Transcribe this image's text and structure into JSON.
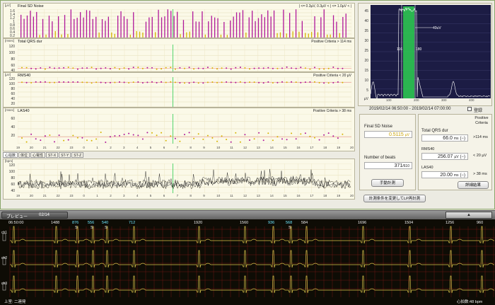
{
  "trend": {
    "noise": {
      "unit": "[µV]",
      "title": "Final SD Noise",
      "legend": "| <= 0.3µV, 0.3µV < | <= 1.0µV < |",
      "yticks": [
        "1.6",
        "1.4",
        "1.2",
        "1",
        "0.8",
        "0.6",
        "0.4",
        "0.2"
      ]
    },
    "qrs": {
      "unit": "[msec]",
      "title": "Total QRS dur",
      "criteria": "Positive Criteria > 114 ms",
      "yticks": [
        "120",
        "100",
        "80",
        "60",
        "40"
      ]
    },
    "rms": {
      "unit": "[µV]",
      "title": "RMS40",
      "criteria": "Positive Criteria < 20 µV",
      "yticks": [
        "120",
        "100",
        "80",
        "60",
        "40",
        "20"
      ]
    },
    "las": {
      "unit": "[msec]",
      "title": "LAS40",
      "criteria": "Positive Criteria > 38 ms",
      "yticks": [
        "60",
        "40",
        "20"
      ]
    },
    "hours": [
      "19",
      "20",
      "21",
      "22",
      "23",
      "0",
      "1",
      "2",
      "3",
      "4",
      "5",
      "6",
      "7",
      "8",
      "9",
      "10",
      "11",
      "12",
      "13",
      "14",
      "15",
      "16",
      "17",
      "18",
      "19",
      "20"
    ],
    "tabs": [
      "心拍数",
      "体位",
      "心電性",
      "ST-X",
      "ST-Y",
      "ST-Z"
    ],
    "hr": {
      "unit": "[bpm]",
      "yticks": [
        "120",
        "100",
        "80",
        "60",
        "40"
      ]
    }
  },
  "spectrum": {
    "yticks": [
      "45",
      "40",
      "35",
      "30",
      "25",
      "20",
      "15",
      "10",
      "5"
    ],
    "xticks": [
      "100",
      "200",
      "300",
      "400"
    ],
    "ylabel": "µV",
    "label_40": "40uV",
    "marker_a": "116",
    "marker_b": "180"
  },
  "date_range": "2019/02/14 06:50:00 - 2019/02/14 07:00:00",
  "register_label": "登録",
  "noise_box": {
    "title": "Final SD Noise",
    "value": "0.5115",
    "unit": "µV",
    "beats_label": "Number of beats",
    "beats_value": "371",
    "beats_total": "/610",
    "manual_button": "手動計測"
  },
  "results": {
    "positive_criteria": "Positive Criteria",
    "qrs_label": "Total QRS dur",
    "qrs_value": "66.0",
    "qrs_unit": "ms",
    "qrs_sign": "(−)",
    "qrs_crit": ">114 ms",
    "rms_label": "RMS40",
    "rms_value": "256.07",
    "rms_unit": "µV",
    "rms_sign": "(−)",
    "rms_crit": "< 20 µV",
    "las_label": "LAS40",
    "las_value": "20.00",
    "las_unit": "ms",
    "las_sign": "(−)",
    "las_crit": "> 38 ms",
    "detail_button": "詳細結果"
  },
  "recalc_button": "計測条件を変更してLP再計測",
  "preview": {
    "label": "プレビュー",
    "page": "02/14",
    "up_arrow": "▲"
  },
  "ecg": {
    "time": "06:50:00",
    "rr_values": [
      "1488",
      "876",
      "556",
      "540",
      "712",
      "1920",
      "1560",
      "936",
      "568",
      "584",
      "1696",
      "1504",
      "1256",
      "960"
    ],
    "beat_labels": [
      "S",
      "S",
      "S",
      "S"
    ],
    "channels": [
      "ch1",
      "ch2",
      "ch3"
    ],
    "bottom_left": "上室: 二連発",
    "bottom_right": "心拍数:48 bpm"
  },
  "colors": {
    "magenta": "#b0189a",
    "gold": "#d6b400",
    "green": "#2ecf52",
    "panelbg": "#fbf9e8",
    "ecg_line": "#d9c34a",
    "ecg_grid": "#6b1414"
  }
}
